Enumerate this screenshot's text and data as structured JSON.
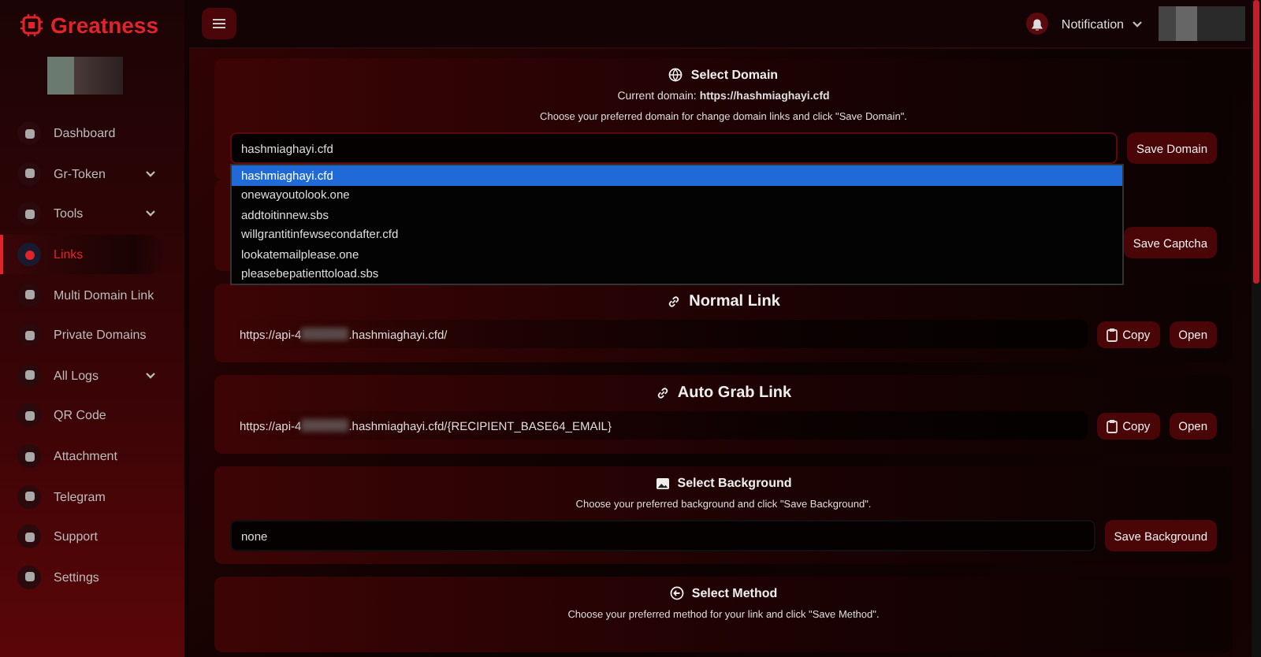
{
  "brand": "Greatness",
  "sidebar": {
    "items": [
      {
        "label": "Dashboard",
        "selected": false,
        "expandable": false
      },
      {
        "label": "Gr-Token",
        "selected": false,
        "expandable": true
      },
      {
        "label": "Tools",
        "selected": false,
        "expandable": true
      },
      {
        "label": "Links",
        "selected": true,
        "expandable": false
      },
      {
        "label": "Multi Domain Link",
        "selected": false,
        "expandable": false
      },
      {
        "label": "Private Domains",
        "selected": false,
        "expandable": false
      },
      {
        "label": "All Logs",
        "selected": false,
        "expandable": true
      },
      {
        "label": "QR Code",
        "selected": false,
        "expandable": false
      },
      {
        "label": "Attachment",
        "selected": false,
        "expandable": false
      },
      {
        "label": "Telegram",
        "selected": false,
        "expandable": false
      },
      {
        "label": "Support",
        "selected": false,
        "expandable": false
      },
      {
        "label": "Settings",
        "selected": false,
        "expandable": false
      }
    ]
  },
  "topbar": {
    "notification": "Notification"
  },
  "domain_card": {
    "title": "Select Domain",
    "current_label": "Current domain:",
    "current_value": "https://hashmiaghayi.cfd",
    "hint": "Choose your preferred domain for change domain links and click \"Save Domain\".",
    "value": "hashmiaghayi.cfd",
    "button": "Save Domain",
    "options": [
      {
        "label": "hashmiaghayi.cfd",
        "selected": true
      },
      {
        "label": "onewayoutolook.one",
        "selected": false
      },
      {
        "label": "addtoitinnew.sbs",
        "selected": false
      },
      {
        "label": "willgrantitinfewsecondafter.cfd",
        "selected": false
      },
      {
        "label": "lookatemailplease.one",
        "selected": false
      },
      {
        "label": "pleasebepatienttoload.sbs",
        "selected": false
      }
    ]
  },
  "captcha_card": {
    "button": "Save Captcha"
  },
  "link_cards": [
    {
      "title": "Normal Link",
      "url_start": "https://api-4",
      "url_end": ".hashmiaghayi.cfd/",
      "copy": "Copy",
      "open": "Open"
    },
    {
      "title": "Auto Grab Link",
      "url_start": "https://api-4",
      "url_end": ".hashmiaghayi.cfd/{RECIPIENT_BASE64_EMAIL}",
      "copy": "Copy",
      "open": "Open"
    }
  ],
  "background_card": {
    "title": "Select Background",
    "hint": "Choose your preferred background and click \"Save Background\".",
    "value": "none",
    "button": "Save Background"
  },
  "method_card": {
    "title": "Select Method",
    "hint": "Choose your preferred method for your link and click \"Save Method\"."
  }
}
